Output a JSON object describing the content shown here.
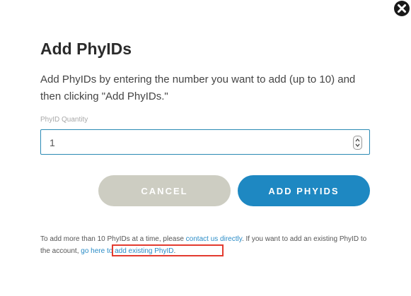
{
  "modal": {
    "title": "Add PhyIDs",
    "description": "Add PhyIDs by entering the number you want to add (up to 10) and then clicking \"Add PhyIDs.\"",
    "quantity_label": "PhyID Quantity",
    "quantity_value": "1",
    "cancel_label": "CANCEL",
    "add_label": "ADD PHYIDS",
    "footer": {
      "text_1": "To add more than 10 PhyIDs at a time, please ",
      "contact_link": "contact us directly",
      "text_2": ". If you want to add an existing PhyID to the account, ",
      "existing_link": "go here to add existing PhyID",
      "text_3": "."
    },
    "close_icon": "close-icon"
  },
  "colors": {
    "primary": "#1e88c2",
    "cancel": "#cdcdc2",
    "link": "#2a8cc7",
    "highlight": "#e33b2f",
    "input_border": "#2b8ab4"
  }
}
